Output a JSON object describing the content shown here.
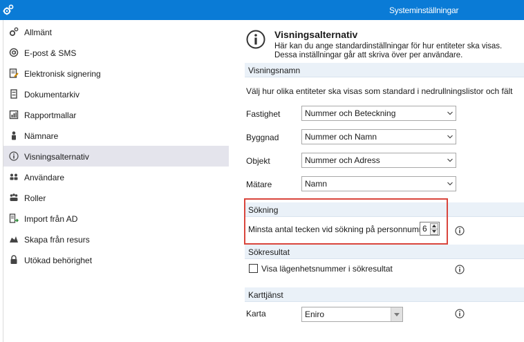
{
  "window": {
    "title": "Systeminställningar",
    "accent": "#0a7bd6"
  },
  "sidebar": {
    "items": [
      {
        "label": "Allmänt",
        "icon": "gears-icon"
      },
      {
        "label": "E-post & SMS",
        "icon": "at-icon"
      },
      {
        "label": "Elektronisk signering",
        "icon": "signing-icon"
      },
      {
        "label": "Dokumentarkiv",
        "icon": "archive-icon"
      },
      {
        "label": "Rapportmallar",
        "icon": "report-icon"
      },
      {
        "label": "Nämnare",
        "icon": "person-icon"
      },
      {
        "label": "Visningsalternativ",
        "icon": "info-icon",
        "selected": true
      },
      {
        "label": "Användare",
        "icon": "users-icon"
      },
      {
        "label": "Roller",
        "icon": "roles-icon"
      },
      {
        "label": "Import från AD",
        "icon": "import-icon"
      },
      {
        "label": "Skapa från resurs",
        "icon": "resource-icon"
      },
      {
        "label": "Utökad behörighet",
        "icon": "lock-icon"
      }
    ]
  },
  "main": {
    "title": "Visningsalternativ",
    "description_line1": "Här kan du ange standardinställningar för hur entiteter ska visas.",
    "description_line2": "Dessa inställningar går att skriva över per användare.",
    "sections": {
      "display_names": {
        "header": "Visningsnamn",
        "intro": "Välj hur olika entiteter ska visas som standard i nedrullningslistor och fält",
        "fields": [
          {
            "label": "Fastighet",
            "value": "Nummer och Beteckning"
          },
          {
            "label": "Byggnad",
            "value": "Nummer och Namn"
          },
          {
            "label": "Objekt",
            "value": "Nummer och Adress"
          },
          {
            "label": "Mätare",
            "value": "Namn"
          }
        ]
      },
      "search": {
        "header": "Sökning",
        "min_chars_label": "Minsta antal tecken vid sökning på personnummer",
        "min_chars_value": "6"
      },
      "search_results": {
        "header": "Sökresultat",
        "checkbox_label": "Visa lägenhetsnummer i sökresultat",
        "checked": false
      },
      "map_service": {
        "header": "Karttjänst",
        "label": "Karta",
        "value": "Eniro"
      }
    }
  },
  "colors": {
    "selection": "#e4e4ec",
    "section_bg": "#eaf1f8",
    "highlight": "#d9443b"
  }
}
